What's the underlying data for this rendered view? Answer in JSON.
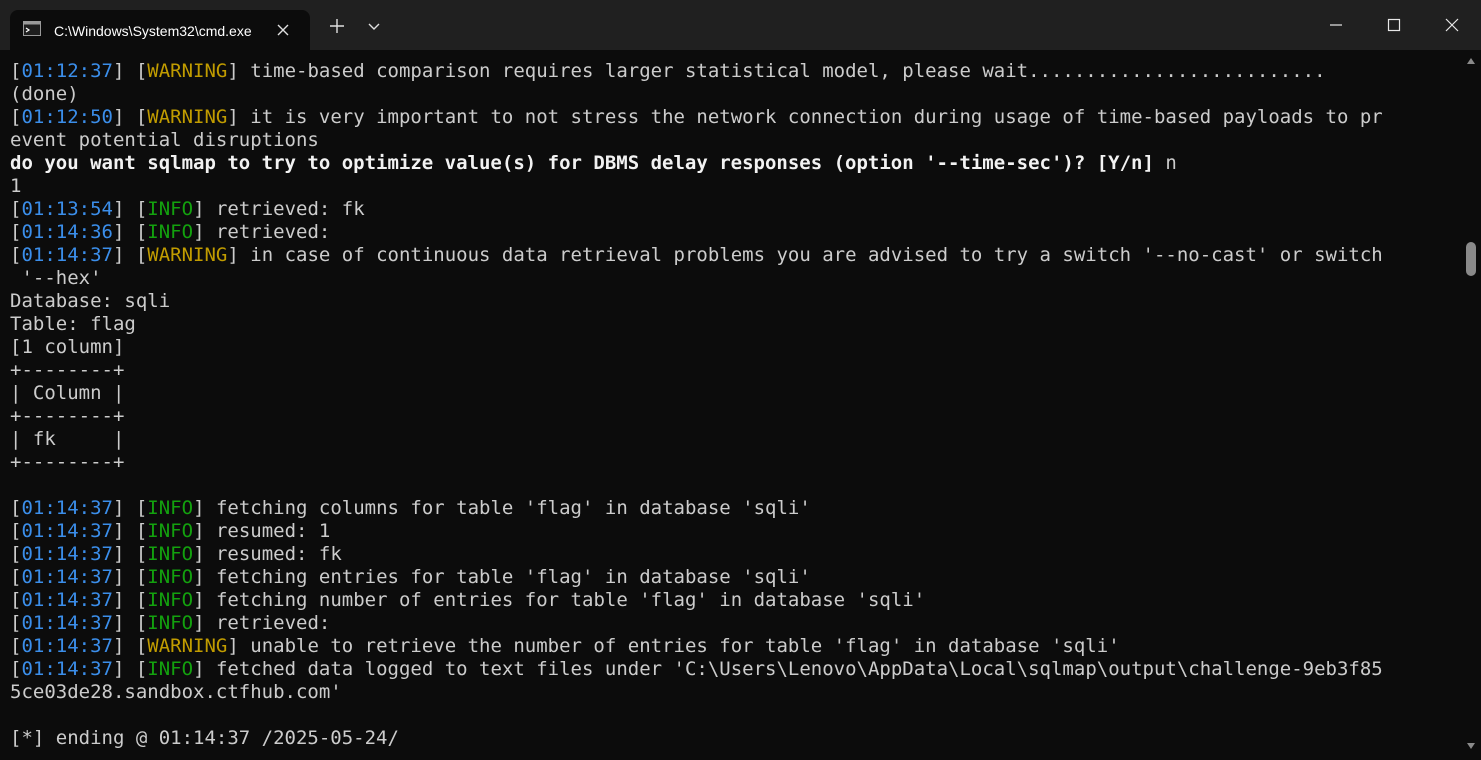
{
  "window": {
    "tab_title": "C:\\Windows\\System32\\cmd.exe",
    "new_tab_symbol": "+",
    "icons": [
      "terminal-icon",
      "close-icon",
      "plus-icon",
      "chevron-down-icon",
      "minimize-icon",
      "maximize-icon",
      "close-icon"
    ]
  },
  "colors": {
    "timestamp": "#3b8eea",
    "warning": "#c19c00",
    "info": "#13a10e",
    "text": "#cccccc",
    "background": "#0c0c0c"
  },
  "terminal": {
    "lines": [
      {
        "type": "log",
        "time": "01:12:37",
        "level": "WARNING",
        "msg": "time-based comparison requires larger statistical model, please wait.........................."
      },
      {
        "type": "plain",
        "text": "(done)"
      },
      {
        "type": "log",
        "time": "01:12:50",
        "level": "WARNING",
        "msg": "it is very important to not stress the network connection during usage of time-based payloads to pr"
      },
      {
        "type": "plain",
        "text": "event potential disruptions"
      },
      {
        "type": "bold",
        "text": "do you want sqlmap to try to optimize value(s) for DBMS delay responses (option '--time-sec')? [Y/n] ",
        "suffix": "n"
      },
      {
        "type": "plain",
        "text": "1"
      },
      {
        "type": "log",
        "time": "01:13:54",
        "level": "INFO",
        "msg": "retrieved: fk"
      },
      {
        "type": "log",
        "time": "01:14:36",
        "level": "INFO",
        "msg": "retrieved:"
      },
      {
        "type": "log",
        "time": "01:14:37",
        "level": "WARNING",
        "msg": "in case of continuous data retrieval problems you are advised to try a switch '--no-cast' or switch"
      },
      {
        "type": "plain",
        "text": " '--hex'"
      },
      {
        "type": "plain",
        "text": "Database: sqli"
      },
      {
        "type": "plain",
        "text": "Table: flag"
      },
      {
        "type": "plain",
        "text": "[1 column]"
      },
      {
        "type": "plain",
        "text": "+--------+"
      },
      {
        "type": "plain",
        "text": "| Column |"
      },
      {
        "type": "plain",
        "text": "+--------+"
      },
      {
        "type": "plain",
        "text": "| fk     |"
      },
      {
        "type": "plain",
        "text": "+--------+"
      },
      {
        "type": "plain",
        "text": ""
      },
      {
        "type": "log",
        "time": "01:14:37",
        "level": "INFO",
        "msg": "fetching columns for table 'flag' in database 'sqli'"
      },
      {
        "type": "log",
        "time": "01:14:37",
        "level": "INFO",
        "msg": "resumed: 1"
      },
      {
        "type": "log",
        "time": "01:14:37",
        "level": "INFO",
        "msg": "resumed: fk"
      },
      {
        "type": "log",
        "time": "01:14:37",
        "level": "INFO",
        "msg": "fetching entries for table 'flag' in database 'sqli'"
      },
      {
        "type": "log",
        "time": "01:14:37",
        "level": "INFO",
        "msg": "fetching number of entries for table 'flag' in database 'sqli'"
      },
      {
        "type": "log",
        "time": "01:14:37",
        "level": "INFO",
        "msg": "retrieved:"
      },
      {
        "type": "log",
        "time": "01:14:37",
        "level": "WARNING",
        "msg": "unable to retrieve the number of entries for table 'flag' in database 'sqli'"
      },
      {
        "type": "log",
        "time": "01:14:37",
        "level": "INFO",
        "msg": "fetched data logged to text files under 'C:\\Users\\Lenovo\\AppData\\Local\\sqlmap\\output\\challenge-9eb3f85"
      },
      {
        "type": "plain",
        "text": "5ce03de28.sandbox.ctfhub.com'"
      },
      {
        "type": "plain",
        "text": ""
      },
      {
        "type": "plain",
        "text": "[*] ending @ 01:14:37 /2025-05-24/"
      }
    ]
  }
}
